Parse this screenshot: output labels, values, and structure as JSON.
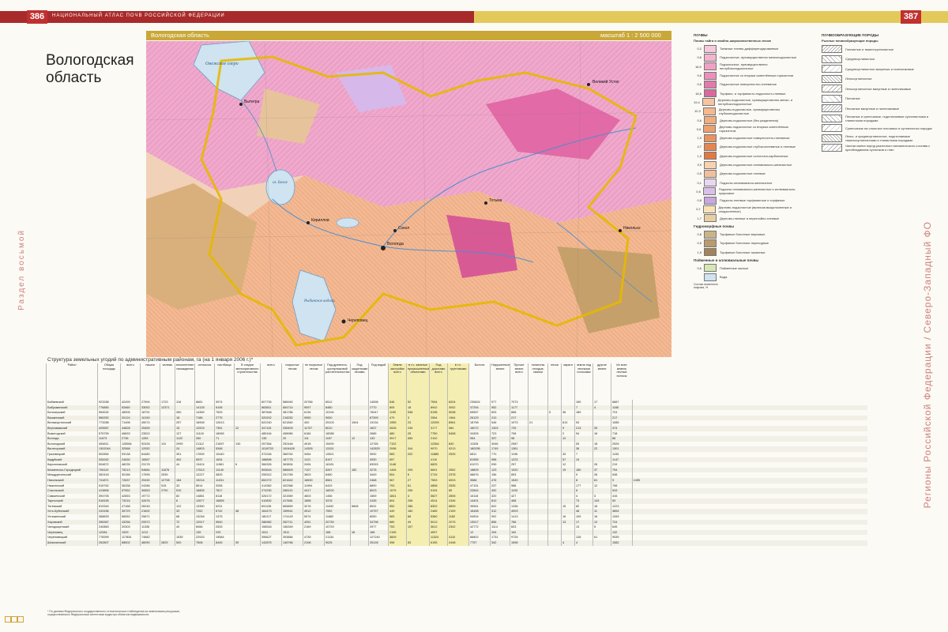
{
  "header": {
    "left_page_number": "386",
    "right_page_number": "387",
    "atlas_title": "НАЦИОНАЛЬНЫЙ АТЛАС ПОЧВ РОССИЙСКОЙ ФЕДЕРАЦИИ",
    "band_left": "Вологодская область",
    "band_scale": "масштаб 1 : 2 500 000"
  },
  "map": {
    "title_line1": "Вологодская",
    "title_line2": "область",
    "labels": [
      "Онежское озеро",
      "оз. Белое",
      "Вологда",
      "Рыбинское водохр.",
      "Череповец",
      "Вытегра",
      "Кириллов",
      "Тотьма",
      "Великий Устюг",
      "Никольск",
      "Сокол"
    ],
    "colors": {
      "podzol": "#f0a0c8",
      "sod": "#f2b27c",
      "peat": "#c9a86e",
      "water": "#cfe3f0",
      "boundary": "#e6b800",
      "river": "#4a8fd0"
    }
  },
  "side": {
    "left": "Раздел восьмой",
    "right": "Регионы Российской Федерации / Северо-Западный ФО"
  },
  "legend_soils": {
    "heading": "ПОЧВЫ",
    "subheading": "Почвы тайги и хвойно-широколиственных лесов",
    "items": [
      {
        "n": "0,2",
        "t": "Таежные глеево-дифференцированные",
        "c": "#f6c9dc"
      },
      {
        "n": "0,6",
        "t": "Подзолистые, преимущественно мелкоподзолистые",
        "c": "#f3b4cf"
      },
      {
        "n": "16,6",
        "t": "Подзолистые, преимущественно неглубокоподзолистые",
        "c": "#f0a2c4"
      },
      {
        "n": "9,6",
        "t": "Подзолистые со вторым осветлённым горизонтом",
        "c": "#ec8fbb"
      },
      {
        "n": "0,6",
        "t": "Подзолистые поверхностно-глееватые",
        "c": "#e27aab"
      },
      {
        "n": "18,6",
        "t": "Торфяно- и торфянисто-подзолисто-глеевые",
        "c": "#d86a9e"
      },
      {
        "n": "19,4",
        "t": "Дерново-подзолистые, преимущественно мелко- и неглубокоподзолистые",
        "c": "#f7c4a0"
      },
      {
        "n": "10,3",
        "t": "Дерново-подзолистые, преимущественно глубокоподзолистые",
        "c": "#f5b88f"
      },
      {
        "n": "0,6",
        "t": "Дерново-подзолистые (без разделения)",
        "c": "#f2ac7e"
      },
      {
        "n": "0,6",
        "t": "Дерново-подзолистые со вторым осветлённым горизонтом",
        "c": "#eea06e"
      },
      {
        "n": "1,9",
        "t": "Дерново-подзолистые поверхностно-глееватые",
        "c": "#ea935f"
      },
      {
        "n": "4,7",
        "t": "Дерново-подзолистые глубокоглееватые и глеевые",
        "c": "#e58651"
      },
      {
        "n": "1,0",
        "t": "Дерново-подзолистые остаточно-карбонатные",
        "c": "#e07a44"
      },
      {
        "n": "3,9",
        "t": "Дерново-подзолистые иллювиально-железистые",
        "c": "#f8d2b0"
      },
      {
        "n": "0,5",
        "t": "Дерново-подзолистые глеевые",
        "c": "#f0c09c"
      },
      {
        "n": "0,1",
        "t": "Подзолы иллювиально-железистые",
        "c": "#e9d7f2"
      },
      {
        "n": "0,6",
        "t": "Подзолы иллювиально-железистые и иллювиально-гумусовые",
        "c": "#d9bfe9"
      },
      {
        "n": "0,8",
        "t": "Подзолы глеевые торфянистые и торфяные",
        "c": "#c8a6df"
      },
      {
        "n": "2,2",
        "t": "Дерново-подзолистые (включая выщелоченные и оподзоленные)",
        "c": "#f9e2b8"
      },
      {
        "n": "1,7",
        "t": "Дерново-глеевые и перегнойно-глеевые",
        "c": "#e8cfa3"
      }
    ],
    "hydro_heading": "Гидроморфные почвы",
    "hydro_items": [
      {
        "n": "0,8",
        "t": "Торфяные болотные верховые",
        "c": "#c9b48a"
      },
      {
        "n": "0,5",
        "t": "Торфяные болотные переходные",
        "c": "#b89c6e"
      },
      {
        "n": "1,5",
        "t": "Торфяные болотные низинные",
        "c": "#a3845a"
      }
    ],
    "flood_heading": "Пойменные и аллювиальные почвы",
    "flood_items": [
      {
        "n": "0,6",
        "t": "Пойменные кислые",
        "c": "#d7e7b4"
      }
    ],
    "water": {
      "n": "",
      "t": "Вода",
      "c": "#cfe3f0"
    },
    "note": "Состав почвенного покрова, %"
  },
  "legend_rocks": {
    "heading": "ПОЧВООБРАЗУЮЩИЕ ПОРОДЫ",
    "subheading": "Рыхлые почвообразующие породы",
    "items": [
      "Глинистые и тяжелосуглинистые",
      "Среднесуглинистые",
      "Среднесуглинистые валунные и галечниковые",
      "Легкосуглинистые",
      "Легкосуглинистые валунные и галечниковые",
      "Песчаные",
      "Песчаные валунные и галечниковые",
      "Песчаные и супесчаные, подстилаемые суглинистыми и глинистыми породами",
      "Супесчаные на слоистых песчаных и суглинистых породах",
      "Легко- и среднесуглинистые, подстилаемые тяжелосуглинистыми и глинистыми породами",
      "Частая смена пород различного механического состава с преобладанием суглинков и глин"
    ]
  },
  "table": {
    "title": "Структура земельных угодий по административным районам, га (на 1 января 2006 г.)*",
    "headers": [
      "Район",
      "Общая площадь",
      "всего",
      "пашня",
      "залежь",
      "многолетние насаждения",
      "сенокосы",
      "пастбища",
      "В стадии мелиоративного строительства",
      "всего",
      "покрытые лесом",
      "не покрытые лесом",
      "Под древесно-кустарниковой растительностью",
      "Под защитными лесами",
      "Под водой",
      "Земли застройки всего",
      "в т.ч. занятые промышленными объектами",
      "Под дорогами всего",
      "в т.ч. грунтовыми",
      "Болота",
      "Нарушенные земли",
      "Прочие земли всего",
      "полигоны отходов, свалки",
      "пески",
      "овраги",
      "земли под лесными полосами",
      "другие земли",
      "Из всех земель лесные полосы"
    ],
    "rows": [
      [
        "Бабаевский",
        "923338",
        "42499",
        "27994",
        "1723",
        "118",
        "8681",
        "3974",
        "",
        "607726",
        "586940",
        "20786",
        "6512",
        "",
        "14598",
        "546",
        "52",
        "7594",
        "6204",
        "235824",
        "977",
        "7073",
        "",
        "",
        "",
        "169",
        "17",
        "6887",
        ""
      ],
      [
        "Бабушкинский",
        "776850",
        "52660",
        "33052",
        "12371",
        "",
        "14128",
        "6106",
        "",
        "663811",
        "654714",
        "9097",
        "8480",
        "",
        "2770",
        "805",
        "18",
        "8942",
        "3052",
        "37254",
        "952",
        "1177",
        "",
        "",
        "",
        "7",
        "4",
        "1166",
        ""
      ],
      [
        "Белозерский",
        "554532",
        "48905",
        "18791",
        "",
        "260",
        "14359",
        "7525",
        "",
        "387848",
        "381786",
        "6134",
        "10194",
        "",
        "76047",
        "1190",
        "538",
        "5198",
        "5038",
        "65557",
        "693",
        "868",
        "",
        "5",
        "36",
        "189",
        "",
        "724",
        ""
      ],
      [
        "Вашкинский",
        "566392",
        "20124",
        "10150",
        "",
        "18",
        "7186",
        "2775",
        "",
        "320202",
        "218252",
        "9950",
        "9050",
        "",
        "87399",
        "479",
        "3",
        "2564",
        "1964",
        "26129",
        "210",
        "217",
        "",
        "",
        "",
        "",
        "",
        "217",
        ""
      ],
      [
        "Великоустюгский",
        "773288",
        "71498",
        "45074",
        "",
        "257",
        "16908",
        "12613",
        "",
        "622240",
        "621840",
        "400",
        "25103",
        "1504",
        "13134",
        "1955",
        "23",
        "12059",
        "8961",
        "18798",
        "546",
        "1973",
        "21",
        "",
        "813",
        "53",
        "",
        "1085",
        ""
      ],
      [
        "Верховажский",
        "425567",
        "44828",
        "25459",
        "",
        "15",
        "12003",
        "7351",
        "12",
        "347115",
        "335409",
        "11707",
        "8010",
        "",
        "1637",
        "2628",
        "235",
        "3177",
        "984",
        "16072",
        "1303",
        "725",
        "",
        "",
        "9",
        "213",
        "39",
        "474",
        ""
      ],
      [
        "Вожегодский",
        "575759",
        "46833",
        "23522",
        "",
        "127",
        "11118",
        "18065",
        "",
        "485164",
        "458980",
        "6184",
        "18288",
        "",
        "2685",
        "480",
        "25",
        "7750",
        "5408",
        "34305",
        "723",
        "708",
        "",
        "",
        "2",
        "54",
        "16",
        "718",
        ""
      ],
      [
        "Вологда",
        "11573",
        "2736",
        "1283",
        "",
        "1122",
        "260",
        "71",
        "",
        "135",
        "20",
        "111",
        "1157",
        "12",
        "133",
        "3917",
        "655",
        "2102",
        "",
        "954",
        "337",
        "98",
        "",
        "",
        "12",
        "",
        "",
        "86",
        ""
      ],
      [
        "Вологодский",
        "454811",
        "128564",
        "92426",
        "110",
        "2999",
        "21112",
        "21697",
        "130",
        "257364",
        "252446",
        "4918",
        "15490",
        "",
        "12765",
        "7102",
        "",
        "12364",
        "840",
        "11528",
        "3046",
        "2587",
        "",
        "",
        "",
        "53",
        "18",
        "2526",
        ""
      ],
      [
        "Вытегорский",
        "1302044",
        "32568",
        "12052",
        "",
        "24",
        "14803",
        "5348",
        "",
        "1018733",
        "1004428",
        "14305",
        "13151",
        "",
        "142829",
        "2098",
        "344",
        "9970",
        "9213",
        "180295",
        "1749",
        "1361",
        "",
        "",
        "",
        "36",
        "22",
        "1301",
        ""
      ],
      [
        "Грязовецкий",
        "502854",
        "93138",
        "64480",
        "",
        "391",
        "17839",
        "10440",
        "",
        "372246",
        "368762",
        "3454",
        "12821",
        "",
        "3092",
        "983",
        "202",
        "11885",
        "2525",
        "6811",
        "770",
        "1196",
        "",
        "",
        "33",
        "7",
        "",
        "1153",
        ""
      ],
      [
        "Кадуйский",
        "326262",
        "24630",
        "16567",
        "",
        "492",
        "5937",
        "1634",
        "",
        "188896",
        "187775",
        "1121",
        "8197",
        "",
        "4930",
        "657",
        "",
        "4110",
        "",
        "81955",
        "958",
        "1223",
        "",
        "",
        "57",
        "19",
        "",
        "1147",
        ""
      ],
      [
        "Кирилловский",
        "504872",
        "48235",
        "23176",
        "",
        "44",
        "13424",
        "11581",
        "6",
        "366326",
        "363834",
        "2494",
        "16181",
        "",
        "83053",
        "1148",
        "",
        "6825",
        "",
        "61070",
        "939",
        "257",
        "",
        "",
        "12",
        "",
        "26",
        "219",
        ""
      ],
      [
        "Кичменгско-Городецкий",
        "706119",
        "75213",
        "54684",
        "11676",
        "",
        "17513",
        "11140",
        "",
        "593616",
        "586509",
        "7107",
        "5267",
        "182",
        "3278",
        "1406",
        "205",
        "6691",
        "2552",
        "18809",
        "123",
        "1020",
        "",
        "",
        "19",
        "180",
        "37",
        "794",
        ""
      ],
      [
        "Междуреченский",
        "362418",
        "30186",
        "17595",
        "2539",
        "",
        "12227",
        "3825",
        "",
        "255312",
        "251789",
        "3603",
        "8480",
        "",
        "3449",
        "504",
        "6",
        "2715",
        "2378",
        "58876",
        "156",
        "853",
        "",
        "",
        "",
        "9",
        "28",
        "638",
        ""
      ],
      [
        "Никольский",
        "741871",
        "72637",
        "29430",
        "12798",
        "184",
        "19214",
        "11031",
        "",
        "652272",
        "621642",
        "18630",
        "8561",
        "",
        "2468",
        "567",
        "27",
        "7553",
        "6003",
        "3586",
        "476",
        "1549",
        "",
        "",
        "",
        "8",
        "81",
        "9",
        "1455"
      ],
      [
        "Нюксенский",
        "516762",
        "36338",
        "24286",
        "515",
        "33",
        "8514",
        "3258",
        "",
        "414362",
        "402368",
        "11994",
        "6429",
        "",
        "8890",
        "793",
        "81",
        "4858",
        "2535",
        "47151",
        "237",
        "988",
        "",
        "",
        "",
        "177",
        "12",
        "798",
        ""
      ],
      [
        "Сокольский",
        "413806",
        "57552",
        "30653",
        "2700",
        "510",
        "16805",
        "7817",
        "",
        "274230",
        "268113",
        "4417",
        "18200",
        "",
        "8023",
        "1575",
        "255",
        "9194",
        "85",
        "22844",
        "492",
        "1193",
        "",
        "",
        "",
        "6",
        "",
        "943",
        ""
      ],
      [
        "Сямженский",
        "394705",
        "42853",
        "19772",
        "",
        "82",
        "14881",
        "8118",
        "",
        "326172",
        "321569",
        "4603",
        "1456",
        "",
        "1569",
        "1841",
        "4",
        "3627",
        "2806",
        "16118",
        "320",
        "427",
        "",
        "",
        "",
        "4",
        "3",
        "416",
        ""
      ],
      [
        "Тарногский",
        "518155",
        "73216",
        "42676",
        "",
        "6",
        "12677",
        "16855",
        "",
        "410832",
        "417681",
        "1858",
        "3378",
        "",
        "2435",
        "804",
        "258",
        "4514",
        "2346",
        "14401",
        "810",
        "468",
        "",
        "",
        "",
        "73",
        "143",
        "59",
        ""
      ],
      [
        "Тотемский",
        "819344",
        "47188",
        "28245",
        "",
        "122",
        "13350",
        "5231",
        "",
        "691138",
        "665859",
        "3278",
        "11632",
        "5808",
        "8531",
        "952",
        "286",
        "8302",
        "6899",
        "35961",
        "602",
        "1336",
        "",
        "",
        "15",
        "82",
        "16",
        "1223",
        ""
      ],
      [
        "Усть-Кубинский",
        "243156",
        "35729",
        "21692",
        "",
        "33",
        "7262",
        "6742",
        "48",
        "164473",
        "159541",
        "4912",
        "7552",
        "",
        "10757",
        "449",
        "180",
        "2485",
        "2159",
        "16458",
        "312",
        "4903",
        "",
        "",
        "",
        "48",
        "11",
        "4854",
        ""
      ],
      [
        "Устюженский",
        "368833",
        "56552",
        "25871",
        "",
        "68",
        "13248",
        "1375",
        "",
        "180117",
        "174143",
        "5974",
        "11682",
        "",
        "8050",
        "983",
        "68",
        "5380",
        "1182",
        "94904",
        "992",
        "1413",
        "",
        "",
        "16",
        "109",
        "16",
        "1283",
        ""
      ],
      [
        "Харовский",
        "396367",
        "43256",
        "20572",
        "",
        "72",
        "12917",
        "9540",
        "",
        "286982",
        "262711",
        "4251",
        "20739",
        "",
        "34798",
        "680",
        "49",
        "5013",
        "2075",
        "13917",
        "856",
        "766",
        "",
        "",
        "13",
        "17",
        "12",
        "724",
        ""
      ],
      [
        "Чагодощенский",
        "240863",
        "20303",
        "11336",
        "",
        "40",
        "6066",
        "2533",
        "",
        "156518",
        "156349",
        "2169",
        "10729",
        "",
        "2977",
        "753",
        "157",
        "3612",
        "2342",
        "42772",
        "1114",
        "603",
        "",
        "",
        "",
        "13",
        "5",
        "645",
        ""
      ],
      [
        "Череповец",
        "12084",
        "1929",
        "1212",
        "",
        "",
        "135",
        "225",
        "",
        "1511",
        "1511",
        "",
        "168",
        "16",
        "168",
        "2155",
        "",
        "4597",
        "",
        "12",
        "294",
        "162",
        "",
        "",
        "",
        "",
        "",
        "132",
        ""
      ],
      [
        "Череповецкий",
        "778399",
        "117834",
        "74682",
        "",
        "1535",
        "22933",
        "19584",
        "",
        "396627",
        "393884",
        "4739",
        "21134",
        "",
        "127240",
        "3609",
        "",
        "11324",
        "4110",
        "86802",
        "1731",
        "9726",
        "",
        "",
        "",
        "128",
        "61",
        "9539",
        ""
      ],
      [
        "Шекснинский",
        "252807",
        "68502",
        "48090",
        "2829",
        "500",
        "7608",
        "8445",
        "39",
        "142875",
        "146766",
        "2108",
        "9025",
        "",
        "25128",
        "398",
        "83",
        "6155",
        "2448",
        "7757",
        "342",
        "1598",
        "",
        "",
        "4",
        "4",
        "",
        "1582",
        ""
      ]
    ]
  },
  "footnote": "* По данным Федерального государственного статистического наблюдения за земельными ресурсами, осуществляемого Федеральным агентством кадастра объектов недвижимости."
}
